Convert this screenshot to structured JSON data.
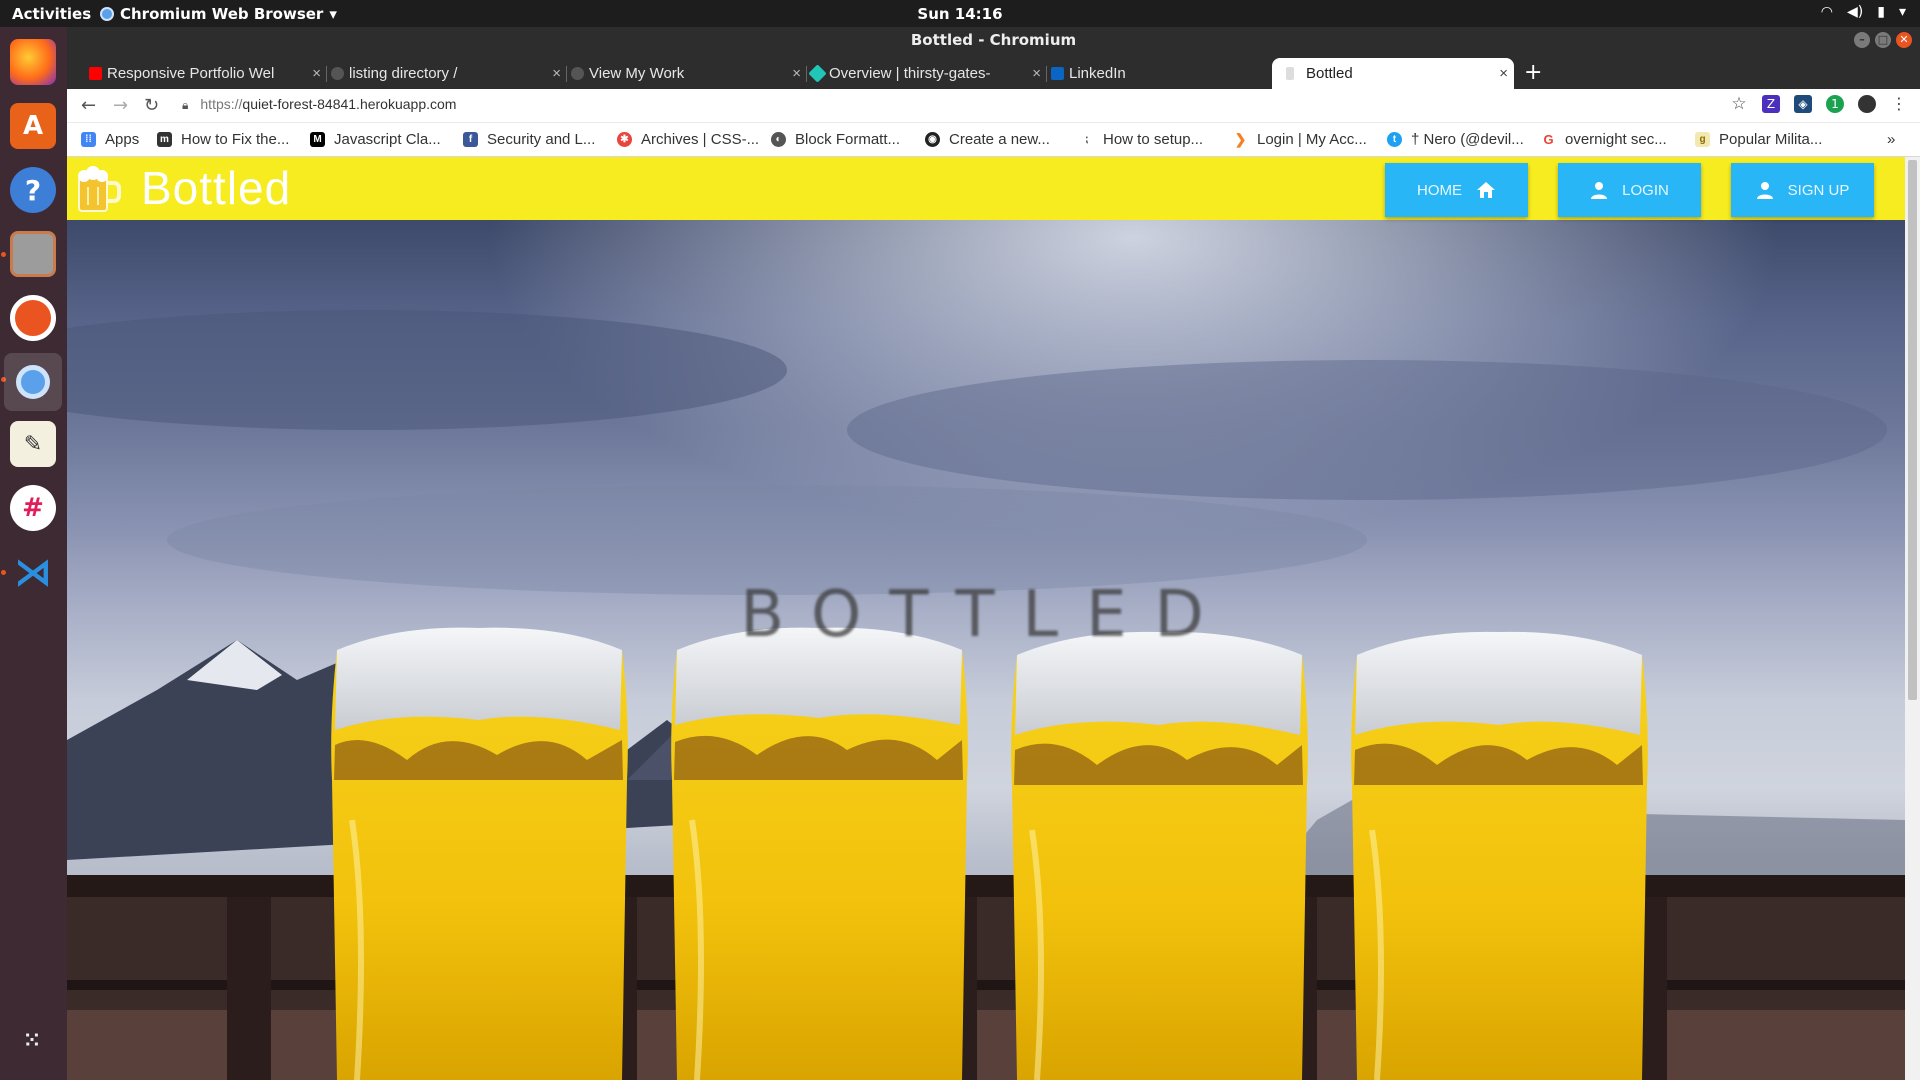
{
  "system": {
    "activities": "Activities",
    "app_name": "Chromium Web Browser",
    "clock": "Sun 14:16"
  },
  "window": {
    "title": "Bottled - Chromium"
  },
  "tabs": [
    {
      "label": "Responsive Portfolio Wel",
      "favicon": "youtube-icon",
      "color": "#ff0000"
    },
    {
      "label": "listing directory /",
      "favicon": "globe-icon",
      "color": "#555555"
    },
    {
      "label": "View My Work",
      "favicon": "globe-icon",
      "color": "#555555"
    },
    {
      "label": "Overview | thirsty-gates-",
      "favicon": "netlify-icon",
      "color": "#20c6b7"
    },
    {
      "label": "LinkedIn",
      "favicon": "linkedin-icon",
      "color": "#0a66c2"
    },
    {
      "label": "Bottled",
      "favicon": "beer-icon",
      "color": "#d9d9d9",
      "active": true
    }
  ],
  "toolbar": {
    "url_prefix": "https://",
    "url_host": "quiet-forest-84841.herokuapp.com"
  },
  "bookmarks": [
    {
      "label": "Apps",
      "icon": "apps-grid-icon",
      "color": "#4285f4"
    },
    {
      "label": "How to Fix the...",
      "icon": "m-icon",
      "color": "#333333"
    },
    {
      "label": "Javascript Cla...",
      "icon": "medium-icon",
      "color": "#000000"
    },
    {
      "label": "Security and L...",
      "icon": "facebook-icon",
      "color": "#3b5998"
    },
    {
      "label": "Archives | CSS-...",
      "icon": "css-tricks-icon",
      "color": "#e8453c"
    },
    {
      "label": "Block Formatt...",
      "icon": "globe-icon",
      "color": "#555555"
    },
    {
      "label": "Create a new...",
      "icon": "github-icon",
      "color": "#222222"
    },
    {
      "label": "How to setup...",
      "icon": "dots-icon",
      "color": "#444444"
    },
    {
      "label": "Login | My Acc...",
      "icon": "chevron-icon",
      "color": "#f48024"
    },
    {
      "label": "† Nero (@devil...",
      "icon": "twitter-icon",
      "color": "#1da1f2"
    },
    {
      "label": "overnight sec...",
      "icon": "google-icon",
      "color": "#ea4335"
    },
    {
      "label": "Popular Milita...",
      "icon": "g-icon",
      "color": "#c9a227"
    }
  ],
  "site": {
    "brand": "Bottled",
    "nav": {
      "home": "HOME",
      "login": "LOGIN",
      "signup": "SIGN UP"
    },
    "hero_title": "BOTTLED",
    "brand_color": "#f7ec1f",
    "button_color": "#29b6f6"
  }
}
